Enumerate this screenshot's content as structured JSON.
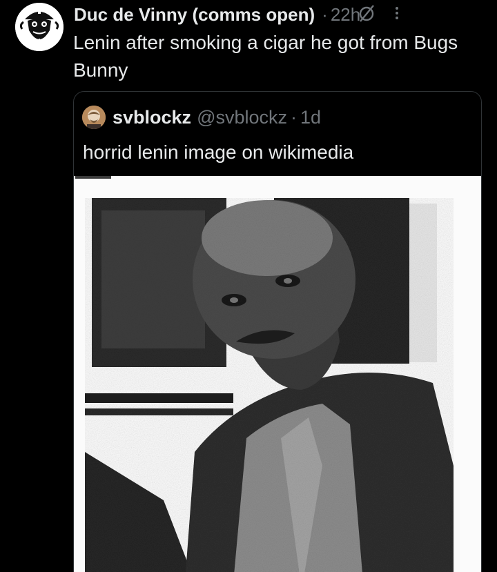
{
  "post": {
    "display_name": "Duc de Vinny (comms open)",
    "separator": "·",
    "time": "22h",
    "text": "Lenin after smoking a cigar he got from Bugs Bunny"
  },
  "quote": {
    "display_name": "svblockz",
    "handle": "@svblockz",
    "separator": "·",
    "time": "1d",
    "text": "horrid lenin image on wikimedia"
  },
  "icons": {
    "author_avatar": "bearded-figure-avatar",
    "grok": "grok-slash-circle-icon",
    "more": "more-vertical-dots-icon",
    "quote_avatar": "portrait-avatar"
  },
  "colors": {
    "background": "#000000",
    "primary_text": "#e7e9ea",
    "secondary_text": "#71767b",
    "border": "#2f3336"
  }
}
